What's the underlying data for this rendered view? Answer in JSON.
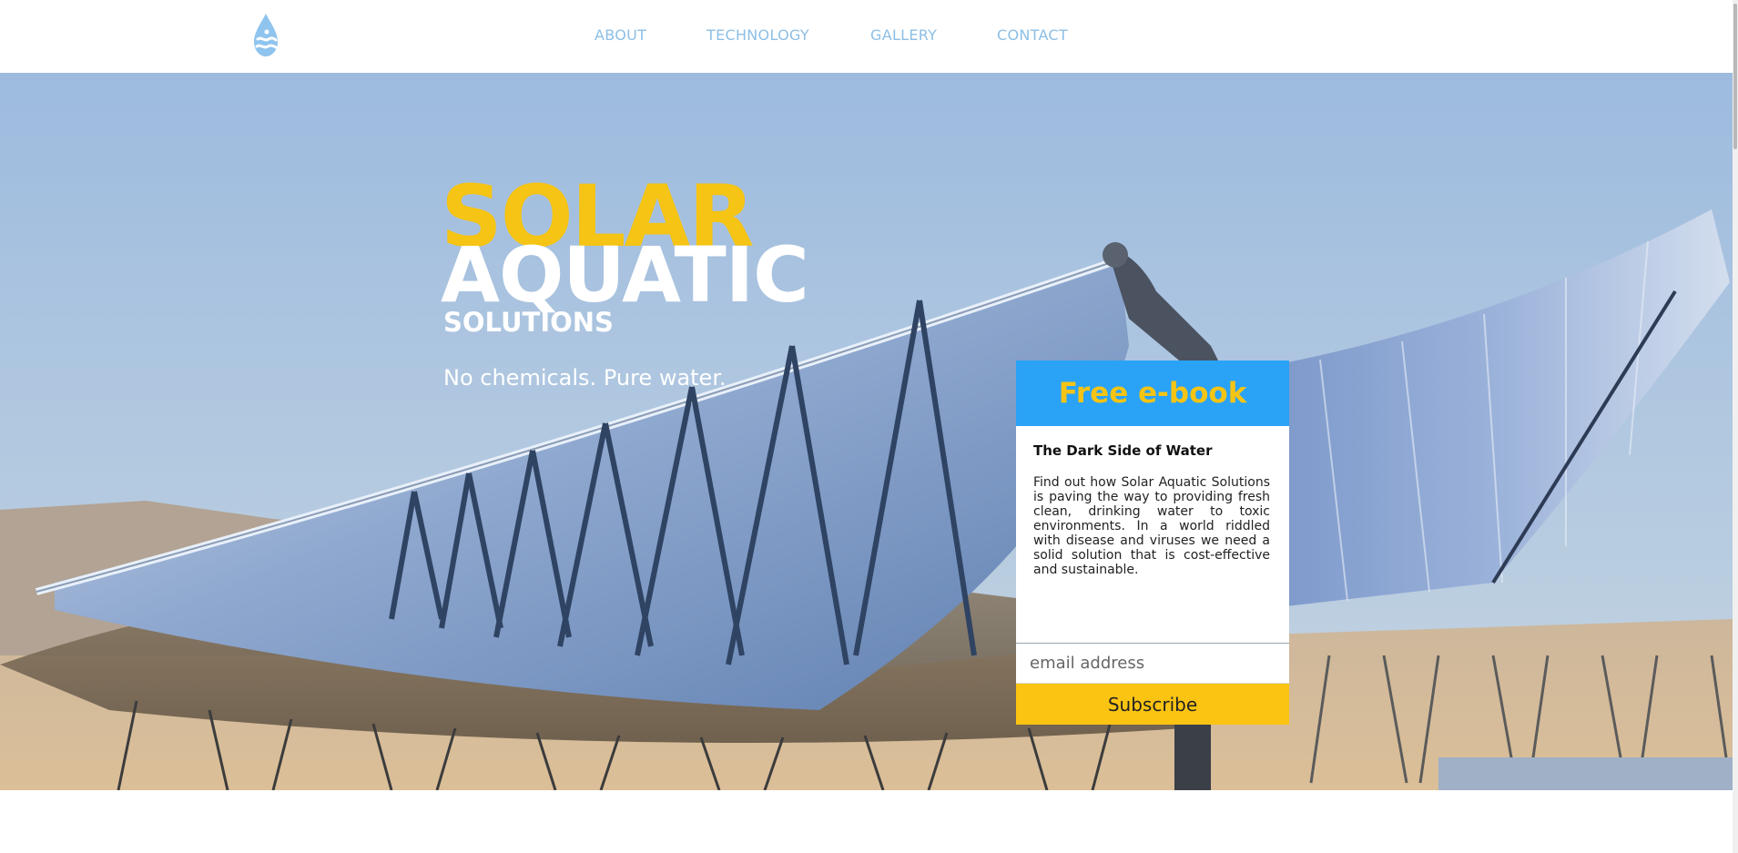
{
  "nav": {
    "logo_icon": "water-drop-icon",
    "items": [
      {
        "label": "ABOUT"
      },
      {
        "label": "TECHNOLOGY"
      },
      {
        "label": "GALLERY"
      },
      {
        "label": "CONTACT"
      }
    ]
  },
  "hero": {
    "title_line1": "SOLAR",
    "title_line2": "AQUATIC",
    "title_line3": "SOLUTIONS",
    "tagline": "No chemicals. Pure water.",
    "background_image": "solar-collector-photo"
  },
  "signup_card": {
    "title": "Free e-book",
    "subtitle": "The Dark Side of Water",
    "body": "Find out how Solar Aquatic Solutions is paving the way to providing fresh clean, drinking water to toxic environments. In a world riddled with disease and viruses we need a solid solution that is cost-effective and sustainable.",
    "email_placeholder": "email address",
    "button_label": "Subscribe"
  },
  "colors": {
    "accent_yellow": "#f5c414",
    "header_blue": "#2aa3f7",
    "nav_link": "#8cbfe6",
    "button_yellow": "#fbc412"
  }
}
